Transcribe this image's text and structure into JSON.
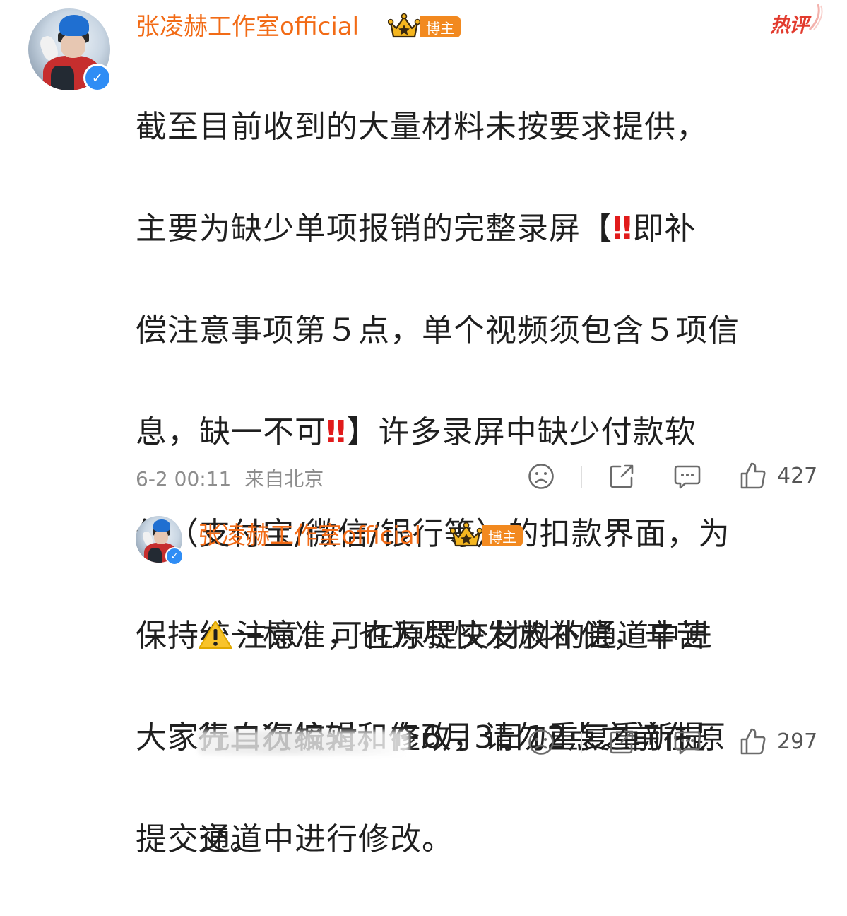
{
  "main_comment": {
    "username": "张凌赫工作室official",
    "badge": "博主",
    "hot_tag": "热评",
    "lines": [
      "截至目前收到的大量材料未按要求提供，",
      "主要为缺少单项报销的完整录屏【",
      "即补",
      "偿注意事项第５点，单个视频须包含５项信",
      "息，缺一不可",
      "】许多录屏中缺少付款软",
      "件（支付宝/微信/银行等）的扣款界面，为",
      "保持统一标准，也为尽快发放补偿，辛苦",
      "大家先自行校对，在6月3日12点之前在原",
      "提交通道中进行修改。"
    ],
    "emoji_double_exclaim": "‼",
    "timestamp": "6-2 00:11",
    "location": "来自北京",
    "like_count": "427"
  },
  "reply": {
    "username": "张凌赫工作室official",
    "badge": "博主",
    "lines": [
      "注意：可在原提交材料的通道中进",
      "行二次编辑和修改，请勿重复重新提",
      "交。"
    ],
    "like_count": "297"
  },
  "colors": {
    "username": "#f26b16",
    "badge_bg": "#f2891f",
    "hot_tag": "#e23b2e",
    "verified": "#2f8df5",
    "emphasis_red": "#e11b1b",
    "meta_gray": "#8d8d8d"
  },
  "icons": [
    "verified-icon",
    "crown-icon",
    "dislike-face-icon",
    "share-icon",
    "comment-icon",
    "like-icon",
    "warning-icon"
  ]
}
